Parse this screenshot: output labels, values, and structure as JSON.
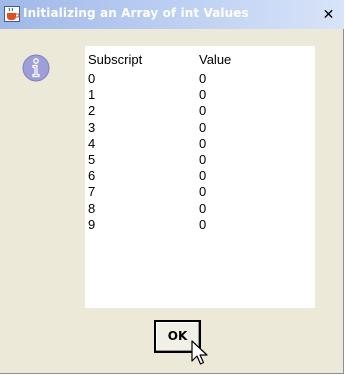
{
  "window": {
    "title": "Initializing an Array of int Values",
    "close_label": "✕",
    "app_icon": "java-cup-icon"
  },
  "message_icon": "information-icon",
  "table": {
    "headers": {
      "subscript": "Subscript",
      "value": "Value"
    },
    "rows": [
      {
        "subscript": "0",
        "value": "0"
      },
      {
        "subscript": "1",
        "value": "0"
      },
      {
        "subscript": "2",
        "value": "0"
      },
      {
        "subscript": "3",
        "value": "0"
      },
      {
        "subscript": "4",
        "value": "0"
      },
      {
        "subscript": "5",
        "value": "0"
      },
      {
        "subscript": "6",
        "value": "0"
      },
      {
        "subscript": "7",
        "value": "0"
      },
      {
        "subscript": "8",
        "value": "0"
      },
      {
        "subscript": "9",
        "value": "0"
      }
    ]
  },
  "buttons": {
    "ok_label": "OK"
  }
}
